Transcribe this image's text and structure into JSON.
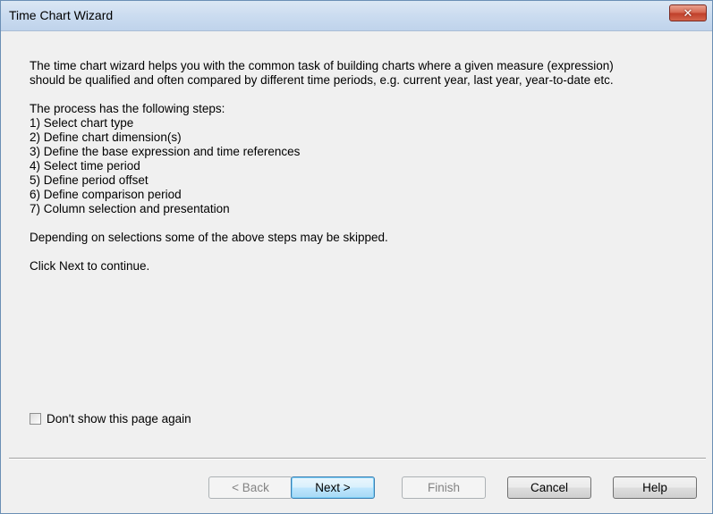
{
  "window": {
    "title": "Time Chart Wizard",
    "close_symbol": "✕"
  },
  "content": {
    "intro_line1": "The time chart wizard helps you with the common task of building charts where a given measure (expression)",
    "intro_line2": "should be qualified and often compared by different time periods, e.g. current year, last year, year-to-date etc.",
    "steps_heading": "The process has the following steps:",
    "steps": [
      "1) Select chart type",
      "2) Define chart dimension(s)",
      "3) Define the base expression and time references",
      "4) Select time period",
      "5) Define period offset",
      "6) Define comparison period",
      "7) Column selection and presentation"
    ],
    "skip_note": "Depending on selections some of the above steps may be skipped.",
    "continue_note": "Click Next to continue."
  },
  "checkbox": {
    "label": "Don't show this page again",
    "checked": false
  },
  "buttons": {
    "back": "< Back",
    "next": "Next >",
    "finish": "Finish",
    "cancel": "Cancel",
    "help": "Help"
  }
}
